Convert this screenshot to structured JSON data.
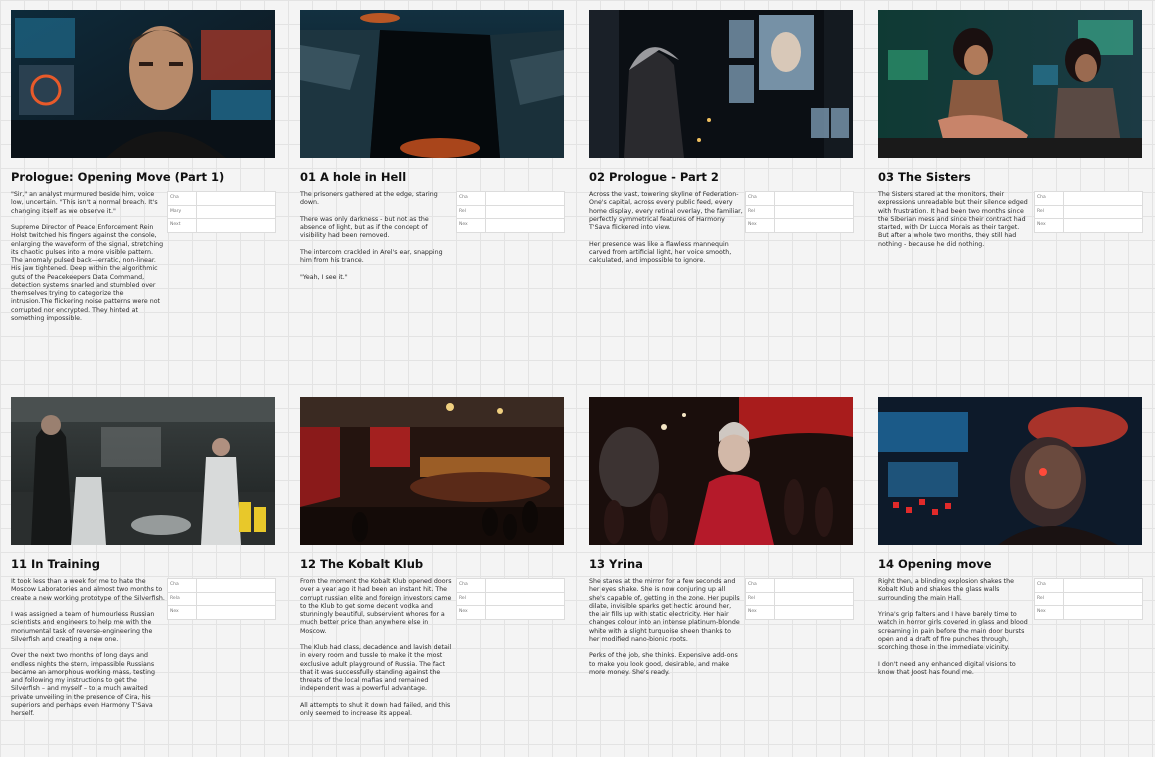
{
  "board": {
    "cards": [
      {
        "title": "Prologue: Opening Move (Part 1)",
        "image": "scene-control-room-man",
        "paragraphs": [
          "\"Sir,\" an analyst murmured beside him, voice low, uncertain. \"This isn't a normal breach. It's changing itself as we observe it.\"",
          "Supreme Director of Peace Enforcement Rein Holst twitched his fingers against the console, enlarging the waveform of the signal, stretching its chaotic pulses into a more visible pattern. The anomaly pulsed back—erratic, non-linear. His jaw tightened. Deep within the algorithmic guts of the Peacekeepers Data Command, detection systems snarled and stumbled over themselves trying to categorize the intrusion.The flickering noise patterns were not corrupted nor encrypted. They hinted at something impossible."
        ],
        "meta": [
          "Cha",
          "Mary",
          "Next"
        ]
      },
      {
        "title": "01 A hole in Hell",
        "image": "scene-abyss",
        "paragraphs": [
          "The prisoners gathered at the edge, staring down.",
          "There was only darkness - but not as the absence of light, but as if the concept of visibility had been removed.",
          "The intercom crackled in Arel's ear, snapping him from his trance.",
          "\"Yeah, I see it.\""
        ],
        "meta": [
          "Cha",
          "Rel",
          "Nex"
        ]
      },
      {
        "title": "02 Prologue - Part 2",
        "image": "scene-city-screens",
        "paragraphs": [
          "Across the vast, towering skyline of Federation-One's capital, across every public feed, every home display, every retinal overlay, the familiar, perfectly symmetrical features of Harmony T'Sava flickered into view.",
          "Her presence was like a flawless mannequin carved from artificial light, her voice smooth, calculated, and impossible to ignore."
        ],
        "meta": [
          "Cha",
          "Rel",
          "Nex"
        ]
      },
      {
        "title": "03 The Sisters",
        "image": "scene-sisters-monitors",
        "paragraphs": [
          "The Sisters stared at the monitors, their expressions unreadable but their silence edged with frustration. It had been two months since the Siberian mess and since their contract had started, with Dr Lucca Morais as their target. But after a whole two months, they still had nothing - because he did nothing."
        ],
        "meta": [
          "Cha",
          "Rel",
          "Nex"
        ]
      },
      {
        "title": "11 In Training",
        "image": "scene-laboratory",
        "paragraphs": [
          "It took less than a week for me to hate the Moscow Laboratories and almost two months to create a new working prototype of the Silverfish.",
          "I was assigned a team of humourless Russian scientists and engineers to help me with the monumental task of reverse-engineering the Silverfish and creating a new one.",
          "Over the next two months of long days and endless nights the stern, impassible Russians became an amorphous working mass, testing and following my instructions to get the Silverfish – and myself – to a much awaited private unveiling in the presence of Cira, his superiors and perhaps even Harmony T'Sava herself."
        ],
        "meta": [
          "Cha",
          "Rela",
          "Nex"
        ]
      },
      {
        "title": "12 The Kobalt Klub",
        "image": "scene-nightclub-hall",
        "paragraphs": [
          "From the moment the Kobalt Klub opened doors over a year ago it had been an instant hit. The corrupt russian elite and foreign investors came to the Klub to get some decent vodka and stunningly beautiful, subservient whores for a much better price than anywhere else in Moscow.",
          "The Klub had class, decadence and lavish detail in every room and tussle to make it the most exclusive adult playground of Russia. The fact that it was successfully standing against the threats of the local mafias and remained independent was a powerful advantage.",
          "All attempts to shut it down had failed, and this only seemed to increase its appeal."
        ],
        "meta": [
          "Cha",
          "Rel",
          "Nex"
        ]
      },
      {
        "title": "13 Yrina",
        "image": "scene-club-woman",
        "paragraphs": [
          "She stares at the mirror for a few seconds and her eyes shake. She is now conjuring up all she's capable of, getting in the zone. Her pupils dilate, invisible sparks get hectic around her, the air fills up with static electricity. Her hair changes colour into an intense platinum-blonde white with a slight turquoise sheen thanks to her modified nano-bionic roots.",
          "Perks of the job, she thinks. Expensive add-ons to make you look good, desirable, and make more money. She's ready."
        ],
        "meta": [
          "Cha",
          "Rel",
          "Nex"
        ]
      },
      {
        "title": "14 Opening move",
        "image": "scene-explosion-face",
        "paragraphs": [
          "Right then, a blinding explosion shakes the Kobalt Klub and shakes the glass walls surrounding the main Hall.",
          "Yrina's grip falters and I have barely time to watch in horror girls covered in glass and blood screaming in pain before the main door bursts open and a draft of fire punches through, scorching those in the immediate vicinity.",
          "I don't need any enhanced digital visions to know that Joost has found me."
        ],
        "meta": [
          "Cha",
          "Rel",
          "Nex"
        ]
      }
    ]
  }
}
